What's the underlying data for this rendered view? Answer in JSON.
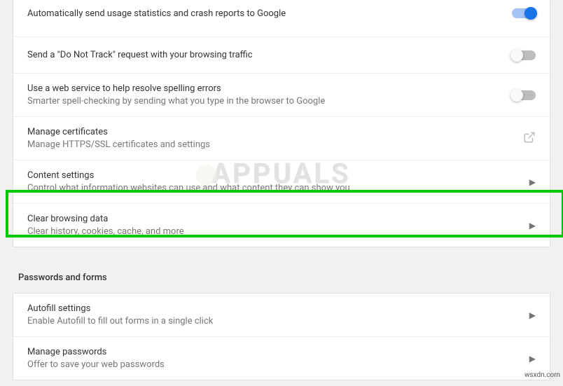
{
  "privacy": {
    "items": [
      {
        "title": "Automatically send usage statistics and crash reports to Google",
        "subtitle": null,
        "control": "toggle",
        "state": "on"
      },
      {
        "title": "Send a \"Do Not Track\" request with your browsing traffic",
        "subtitle": null,
        "control": "toggle",
        "state": "off"
      },
      {
        "title": "Use a web service to help resolve spelling errors",
        "subtitle": "Smarter spell-checking by sending what you type in the browser to Google",
        "control": "toggle",
        "state": "off"
      },
      {
        "title": "Manage certificates",
        "subtitle": "Manage HTTPS/SSL certificates and settings",
        "control": "external",
        "state": null
      },
      {
        "title": "Content settings",
        "subtitle": "Control what information websites can use and what content they can show you",
        "control": "chevron",
        "state": null
      },
      {
        "title": "Clear browsing data",
        "subtitle": "Clear history, cookies, cache, and more",
        "control": "chevron",
        "state": null,
        "highlighted": true
      }
    ]
  },
  "passwords": {
    "heading": "Passwords and forms",
    "items": [
      {
        "title": "Autofill settings",
        "subtitle": "Enable Autofill to fill out forms in a single click",
        "control": "chevron"
      },
      {
        "title": "Manage passwords",
        "subtitle": "Offer to save your web passwords",
        "control": "chevron"
      }
    ]
  },
  "watermark_text": "APPUALS",
  "footer": "wsxdn.com"
}
